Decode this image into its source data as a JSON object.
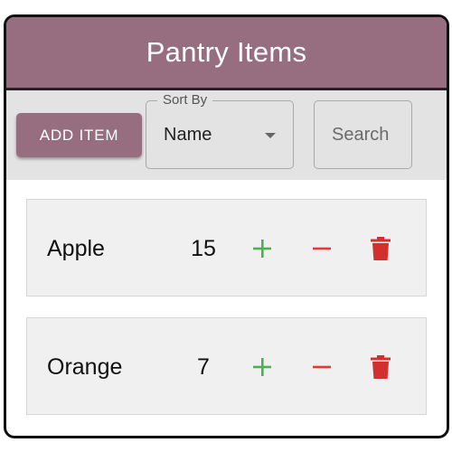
{
  "header": {
    "title": "Pantry Items"
  },
  "toolbar": {
    "add_label": "ADD ITEM",
    "sort_label": "Sort By",
    "sort_value": "Name",
    "search_placeholder": "Search"
  },
  "items": [
    {
      "name": "Apple",
      "quantity": "15"
    },
    {
      "name": "Orange",
      "quantity": "7"
    }
  ],
  "icons": {
    "increment": "plus-icon",
    "decrement": "minus-icon",
    "delete": "trash-icon",
    "sort": "caret-down-icon"
  },
  "colors": {
    "brand": "#976d80",
    "increment": "#4caf50",
    "decrement": "#e53935",
    "delete": "#d32f2f",
    "toolbar_bg": "#e3e3e3",
    "item_bg": "#f0f0f0"
  }
}
